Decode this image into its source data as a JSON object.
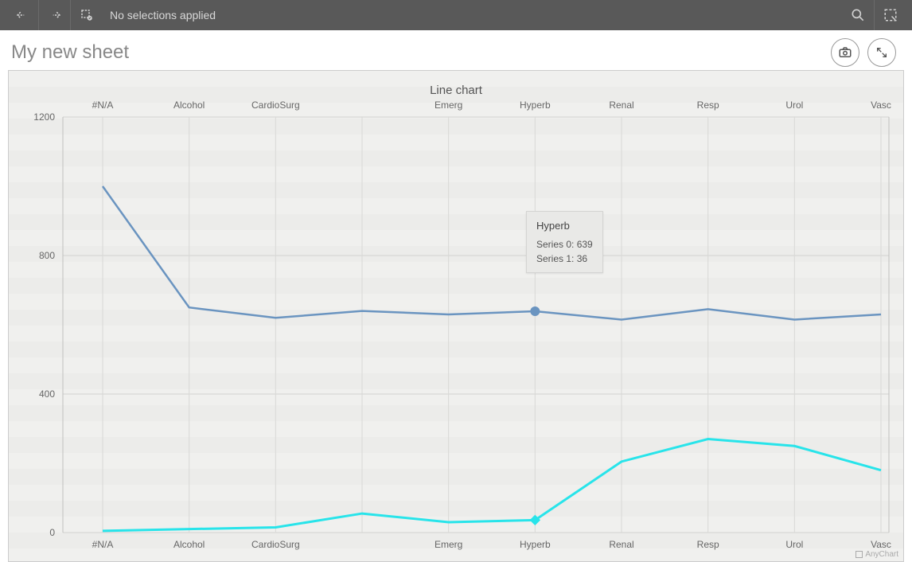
{
  "toolbar": {
    "selections_text": "No selections applied"
  },
  "sheet": {
    "title": "My new sheet"
  },
  "chart_data": {
    "type": "line",
    "title": "Line chart",
    "categories": [
      "#N/A",
      "Alcohol",
      "CardioSurg",
      "",
      "Emerg",
      "Hyperb",
      "Renal",
      "Resp",
      "Urol",
      "Vasc"
    ],
    "series": [
      {
        "name": "Series 0",
        "values": [
          1000,
          650,
          620,
          640,
          630,
          639,
          615,
          645,
          615,
          630
        ]
      },
      {
        "name": "Series 1",
        "values": [
          5,
          10,
          15,
          55,
          30,
          36,
          205,
          270,
          250,
          180
        ]
      }
    ],
    "ylim": [
      0,
      1200
    ],
    "yticks": [
      0,
      400,
      800,
      1200
    ],
    "xlabel": "",
    "ylabel": ""
  },
  "tooltip": {
    "category": "Hyperb",
    "lines": [
      "Series 0: 639",
      "Series 1: 36"
    ],
    "highlight_index": 5
  },
  "watermark": "AnyChart"
}
